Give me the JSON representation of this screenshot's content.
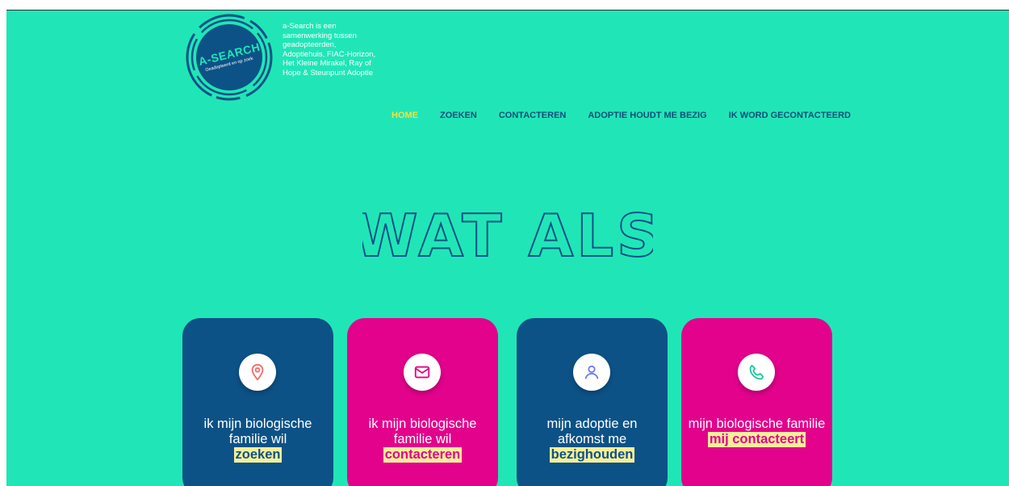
{
  "logo": {
    "title": "A-SEARCH",
    "subtitle": "Geadopteerd en op zoek"
  },
  "tagline": "a-Search is een samenwerking tussen geadopteerden, Adoptiehuis, FIAC-Horizon, Het Kleine Mirakel, Ray of Hope & Steunpunt Adoptie",
  "nav": {
    "items": [
      {
        "label": "HOME",
        "active": true
      },
      {
        "label": "ZOEKEN",
        "active": false
      },
      {
        "label": "CONTACTEREN",
        "active": false
      },
      {
        "label": "ADOPTIE HOUDT ME BEZIG",
        "active": false
      },
      {
        "label": "IK WORD GECONTACTEERD",
        "active": false
      }
    ]
  },
  "headline": "WAT ALS",
  "cards": [
    {
      "icon": "location-pin-icon",
      "text": "ik mijn biologische familie wil",
      "highlight": "zoeken",
      "color": "#0d5286"
    },
    {
      "icon": "mail-icon",
      "text": "ik mijn biologische familie wil",
      "highlight": "contacteren",
      "color": "#e3028b"
    },
    {
      "icon": "user-icon",
      "text": "mijn adoptie en afkomst me",
      "highlight": "bezighouden",
      "color": "#0d5286"
    },
    {
      "icon": "phone-icon",
      "text": "mijn biologische familie",
      "highlight": "mij contacteert",
      "color": "#e3028b"
    }
  ],
  "colors": {
    "background": "#20e6b7",
    "navy": "#0d5286",
    "pink": "#e3028b",
    "nav_active": "#f5e23a",
    "highlight": "#f6ef9a"
  }
}
